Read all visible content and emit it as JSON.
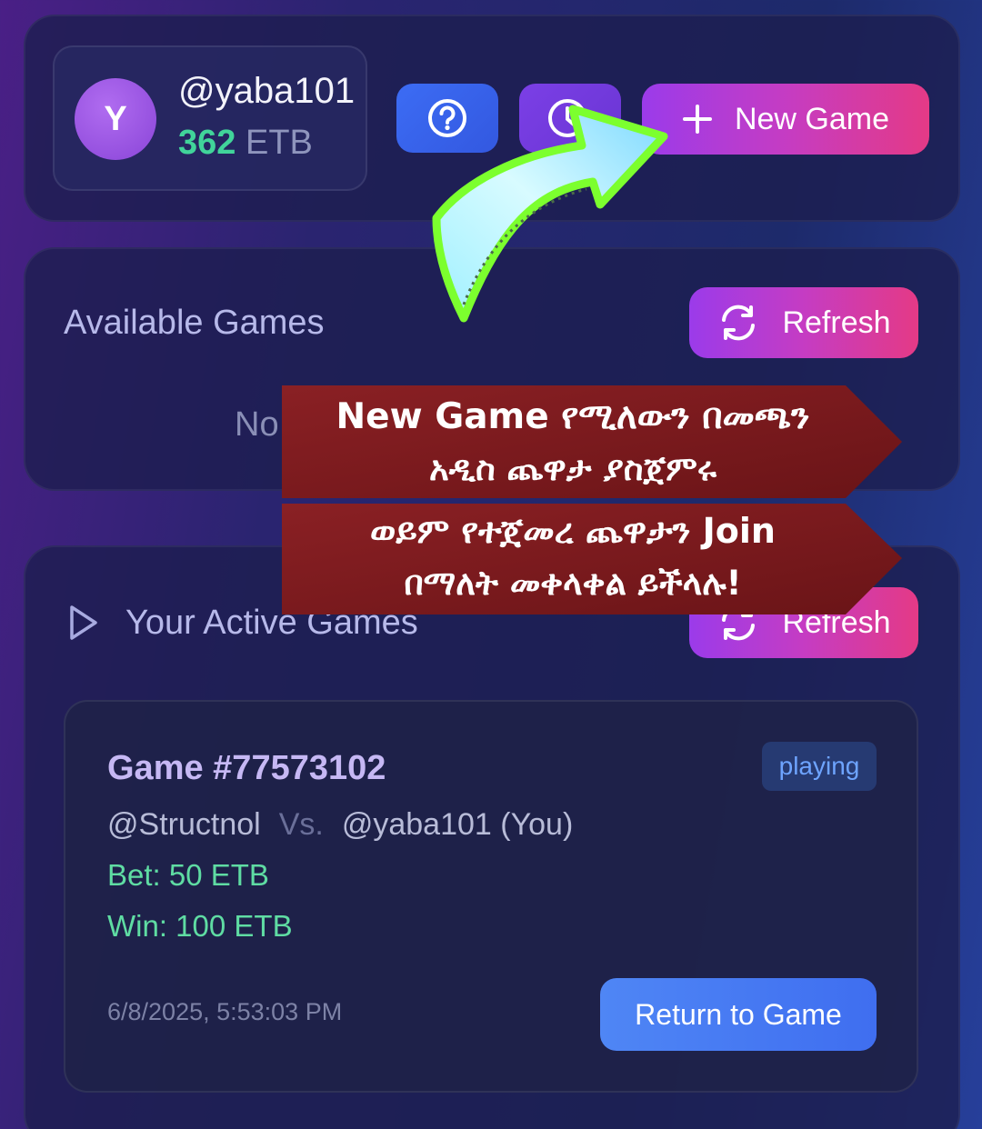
{
  "profile": {
    "avatar_initial": "Y",
    "username": "@yaba101",
    "balance_amount": "362",
    "balance_currency": "ETB"
  },
  "header": {
    "help_icon": "question-circle-icon",
    "history_icon": "clock-icon",
    "new_game_icon": "plus-icon",
    "new_game_label": "New Game"
  },
  "available": {
    "title": "Available Games",
    "refresh_label": "Refresh",
    "empty_text_visible": "No"
  },
  "active": {
    "title": "Your Active Games",
    "refresh_label": "Refresh"
  },
  "game": {
    "title": "Game #77573102",
    "status": "playing",
    "opponent": "@Structnol",
    "vs": "Vs.",
    "self": "@yaba101 (You)",
    "bet": "Bet: 50 ETB",
    "win": "Win: 100 ETB",
    "date": "6/8/2025, 5:53:03 PM",
    "return_label": "Return to Game"
  },
  "callout": {
    "line1": "New Game የሚለውን በመጫን",
    "line2": "አዲስ ጨዋታ ያስጀምሩ",
    "line3": "ወይም የተጀመረ ጨዋታን Join",
    "line4": "በማለት መቀላቀል ይችላሉ!"
  },
  "colors": {
    "accent_gradient_start": "#9b3bea",
    "accent_gradient_end": "#e43a86",
    "balance_green": "#41d49a",
    "callout_red": "#7a1a1e",
    "arrow_green": "#7cff2e"
  }
}
